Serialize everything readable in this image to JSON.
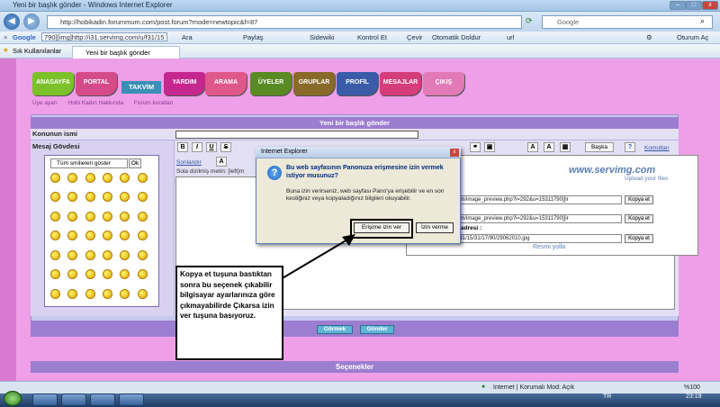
{
  "window": {
    "title": "Yeni bir başlık gönder - Windows Internet Explorer"
  },
  "address": {
    "url": "http://hobikadin.forummum.com/post.forum?mode=newtopic&f=87",
    "search_placeholder": "Google"
  },
  "google_toolbar": {
    "label": "Google",
    "query": "790][img]http://i31.servimg.com/u/f31/15",
    "items": [
      "Ara",
      "Paylaş",
      "Sidewiki",
      "Kontrol Et",
      "Çevir",
      "Otomatik Doldur",
      "url"
    ],
    "signin": "Oturum Aç"
  },
  "favorites": {
    "label": "Sık Kullanılanlar",
    "tab": "Yeni bir başlık gönder"
  },
  "forum_nav": {
    "items": [
      "ANASAYFA",
      "PORTAL",
      "TAKVİM",
      "YARDIM",
      "ARAMA",
      "ÜYELER",
      "GRUPLAR",
      "PROFİL",
      "MESAJLAR",
      "ÇIKIŞ"
    ],
    "sublinks": [
      "Üye ayarı",
      "Hobi Kadın Hakkında",
      "Forum kuralları"
    ]
  },
  "post_form": {
    "header": "Yeni bir başlık gönder",
    "subject_label": "Konunun ismi",
    "body_label": "Mesaj Gövdesi",
    "smiley_select": "Tüm smilieleri göster",
    "ok_label": "Ok",
    "toolbar_more": "Başka",
    "comments_link": "Komutları",
    "sizes_link": "Sonlandır",
    "line_info": "Sola dizilmiş metin: [left]m",
    "preview_btn": "Görmek",
    "send_btn": "Gönder",
    "options_header": "Seçenekler"
  },
  "servimg": {
    "logo": "www.servimg.com",
    "tagline": "Upload your files",
    "link1": "www.servimg.com/image_preview.php?i=292&u=15311790][ir",
    "link2": "www.servimg.com/image_preview.php?i=292&u=15311790][ir",
    "link3_label": "adresi :",
    "link3": "servimg.com/u/f31/15/31/17/90/29062010.jpg",
    "copy_btn": "Kopya et",
    "resmi_yolla": "Resmi yolla"
  },
  "dialog": {
    "title": "Internet Explorer",
    "question": "Bu web sayfasının Panonuza erişmesine izin vermek istiyor musunuz?",
    "body": "Buna izin verirseniz, web sayfası Pano'ya erişebilir ve en son kestiğiniz veya kopyaladığınız bilgileri okuyabilir.",
    "allow_btn": "Erişime izin ver",
    "deny_btn": "İzin verme"
  },
  "note": {
    "text": "Kopya et tuşuna bastıktan sonra bu seçenek çıkabilir bilgisayar ayarlarınıza göre çıkmayabilirde Çıkarsa izin ver tuşuna basıyoruz."
  },
  "status": {
    "zone": "Internet | Korumalı Mod: Açık",
    "zoom": "%100"
  },
  "tray": {
    "lang": "TR",
    "time": "23:19"
  }
}
